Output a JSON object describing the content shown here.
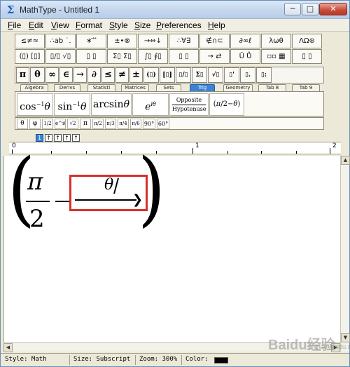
{
  "window": {
    "title": "MathType - Untitled 1",
    "buttons": {
      "minimize": "─",
      "maximize": "□",
      "close": "✕"
    }
  },
  "menu": [
    {
      "label": "File"
    },
    {
      "label": "Edit"
    },
    {
      "label": "View"
    },
    {
      "label": "Format"
    },
    {
      "label": "Style"
    },
    {
      "label": "Size"
    },
    {
      "label": "Preferences"
    },
    {
      "label": "Help"
    }
  ],
  "palette_row1": [
    "≤≠≈",
    "∴ab ˙.",
    "∗ ⃗ ⃗",
    "±•⊗",
    "→⇔↓",
    "∴∀∃",
    "∉∩⊂",
    "∂∞ℓ",
    "λωθ",
    "ΛΩ⊛"
  ],
  "palette_row2": [
    "(▯) [▯]",
    "▯/▯ √▯",
    "▯ ▯",
    "Σ▯ Σ▯",
    "∫▯ ∮▯",
    "▯ ▯",
    "→ ⇄",
    "Ū Ů",
    "▫▫ ▦",
    "▯ ▯"
  ],
  "palette_row3": [
    "π",
    "θ",
    "∞",
    "∈",
    "→",
    "∂",
    "≤",
    "≠",
    "±",
    "(▯)",
    "[▯]",
    "▯/▯",
    "Σ▯",
    "√▯",
    "▯'",
    "▯.",
    "▯:"
  ],
  "tabs": [
    "Algebra",
    "Derivs",
    "Statisti",
    "Matrices",
    "Sets",
    "Trig",
    "Geometry",
    "Tab 8",
    "Tab 9"
  ],
  "active_tab": "Trig",
  "templates": [
    "cos⁻¹θ",
    "sin⁻¹θ",
    "arcsinθ",
    "e^iθ",
    "Opposite/Hypotenuse",
    "(π/2 − θ)"
  ],
  "template_parts": {
    "cos": "cos",
    "cos_sup": "−1",
    "sin": "sin",
    "sin_sup": "−1",
    "arcsin": "arcsin",
    "theta": "θ",
    "e": "e",
    "e_sup": "iθ",
    "opposite": "Opposite",
    "hypotenuse": "Hypotenuse",
    "pi": "π",
    "two": "2",
    "minus_theta": "−θ"
  },
  "small_row": [
    "θ",
    "φ",
    "1/2",
    "e^iθ",
    "√2",
    "π",
    "π/2",
    "π/3",
    "π/4",
    "π/6",
    "90°",
    "60°"
  ],
  "nav_buttons": [
    "1",
    "↑",
    "↑",
    "↑",
    "↑"
  ],
  "ruler_labels": [
    "0",
    "1",
    "2"
  ],
  "equation": {
    "numerator": "π",
    "denominator": "2",
    "placeholder_var": "θ"
  },
  "status": {
    "style": "Style: Math",
    "size": "Size: Subscript",
    "zoom": "Zoom: 300%",
    "color_label": "Color:",
    "color_value": "#000000"
  },
  "watermark": {
    "main": "Baidu经验",
    "sub": "jingyan.baidu.com"
  }
}
